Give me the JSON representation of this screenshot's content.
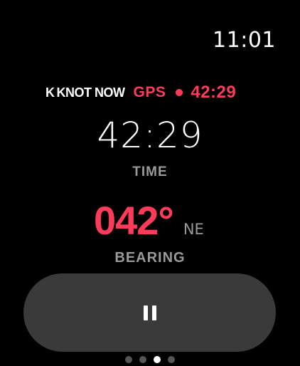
{
  "clock": "11:01",
  "status": {
    "brand": "KNOT NOW",
    "brand_mark": "K",
    "gps_label": "GPS",
    "elapsed": "42:29"
  },
  "metrics": {
    "time_value": "42:29",
    "time_label": "TIME",
    "bearing_value": "042°",
    "bearing_direction": "NE",
    "bearing_label": "BEARING"
  },
  "controls": {
    "pause_icon": "pause-icon"
  },
  "pagination": {
    "total": 4,
    "active_index": 2
  },
  "colors": {
    "accent": "#ff3b5c",
    "secondary_text": "#9a9a9a",
    "button_bg": "#3a3a3a"
  }
}
